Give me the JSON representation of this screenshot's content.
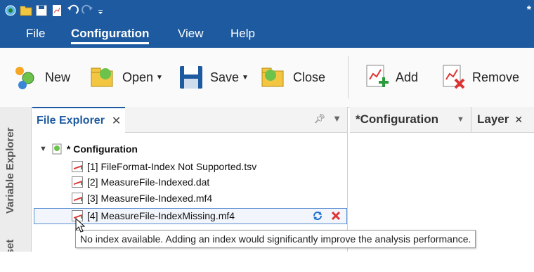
{
  "titlebar": {
    "modified_marker": "*"
  },
  "menu": {
    "file": "File",
    "configuration": "Configuration",
    "view": "View",
    "help": "Help"
  },
  "ribbon": {
    "new": "New",
    "open": "Open",
    "save": "Save",
    "close": "Close",
    "add": "Add",
    "remove": "Remove"
  },
  "side_tabs": {
    "variable_explorer": "Variable Explorer",
    "offset": "Offset"
  },
  "file_explorer": {
    "tab_title": "File Explorer",
    "root": "* Configuration",
    "files": [
      "[1] FileFormat-Index Not Supported.tsv",
      "[2] MeasureFile-Indexed.dat",
      "[3] MeasureFile-Indexed.mf4",
      "[4] MeasureFile-IndexMissing.mf4"
    ]
  },
  "right_tabs": {
    "configuration": "*Configuration",
    "layer": "Layer"
  },
  "tooltip": "No index available. Adding an index would significantly improve the analysis performance."
}
